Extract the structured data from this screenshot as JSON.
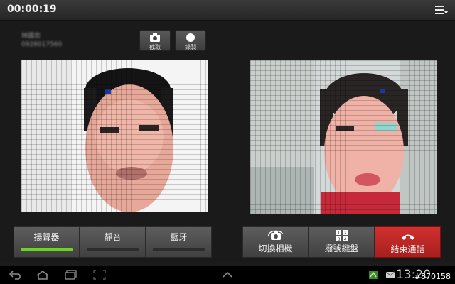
{
  "status_bar": {
    "timer": "00:00:19",
    "menu_icon": "menu-icon"
  },
  "caller": {
    "name": "林國忠",
    "number": "0928017560"
  },
  "actions": {
    "capture_label": "截取",
    "record_label": "錄製"
  },
  "controls": {
    "speaker": {
      "label": "揚聲器",
      "active": true
    },
    "mute": {
      "label": "靜音",
      "active": false
    },
    "bluetooth": {
      "label": "藍牙",
      "active": false
    },
    "switch_camera": {
      "label": "切換相機"
    },
    "keypad": {
      "label": "撥號鍵盤"
    },
    "end_call": {
      "label": "結束通話"
    }
  },
  "nav": {
    "clock": "13:20",
    "watermark": "#870158"
  },
  "colors": {
    "accent_green": "#6bd61c",
    "end_red": "#c42a28"
  }
}
